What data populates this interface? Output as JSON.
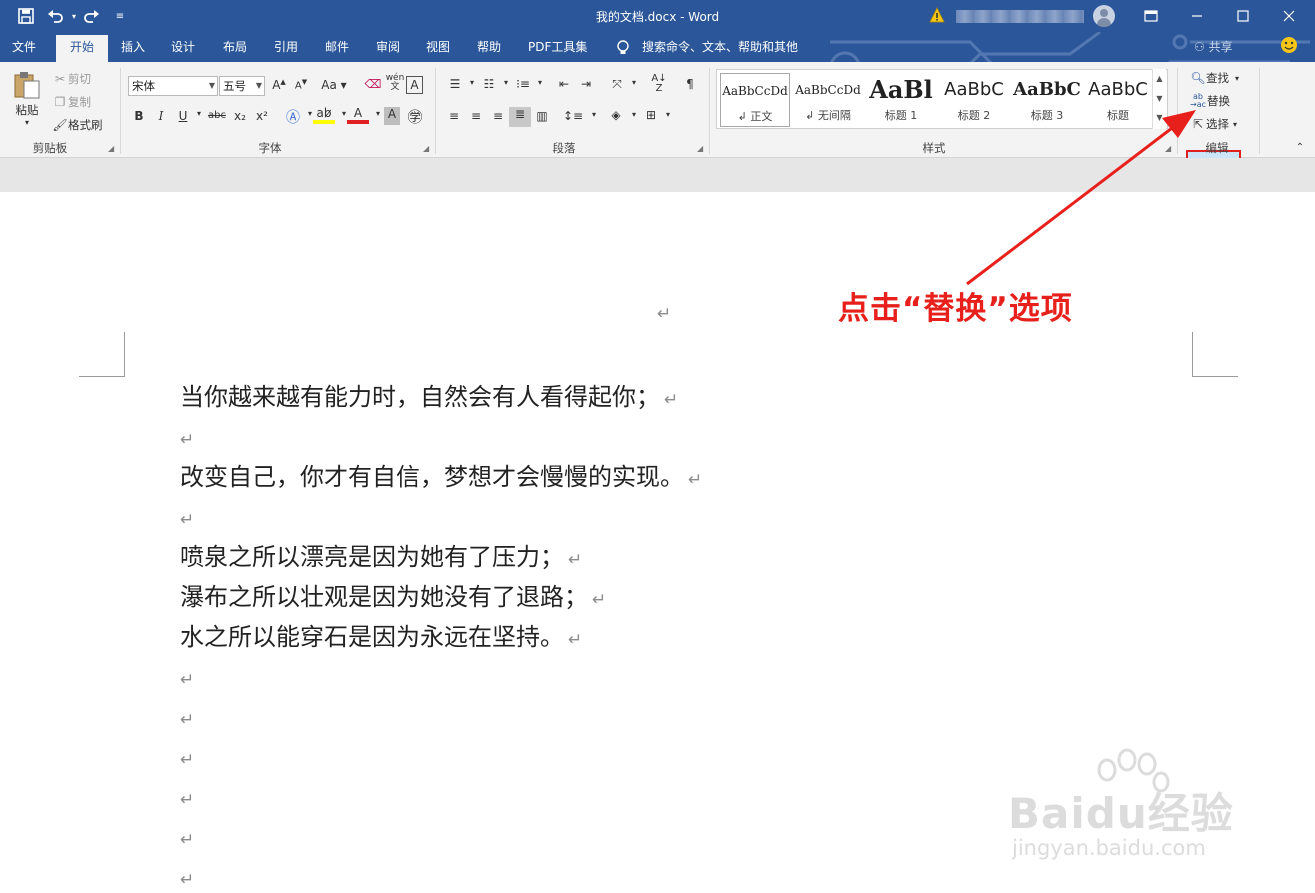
{
  "titlebar": {
    "title": "我的文档.docx  -  Word",
    "user_name": "▓▓▓▓▓▓▓▓▓▓▓▓"
  },
  "tabs": [
    "文件",
    "开始",
    "插入",
    "设计",
    "布局",
    "引用",
    "邮件",
    "审阅",
    "视图",
    "帮助",
    "PDF工具集"
  ],
  "search_hint": "搜索命令、文本、帮助和其他",
  "share_label": "共享",
  "clipboard": {
    "paste": "粘贴",
    "cut": "剪切",
    "copy": "复制",
    "format_painter": "格式刷",
    "group": "剪贴板"
  },
  "font": {
    "name": "宋体",
    "size": "五号",
    "group": "字体",
    "bold": "B",
    "italic": "I",
    "underline": "U",
    "strike": "abc",
    "subscript": "x₂",
    "superscript": "x²"
  },
  "paragraph": {
    "group": "段落"
  },
  "styles": {
    "group": "样式",
    "items": [
      {
        "preview": "AaBbCcDd",
        "name": "↲ 正文"
      },
      {
        "preview": "AaBbCcDd",
        "name": "↲ 无间隔"
      },
      {
        "preview": "AaBl",
        "name": "标题 1"
      },
      {
        "preview": "AaBbC",
        "name": "标题 2"
      },
      {
        "preview": "AaBbC",
        "name": "标题 3"
      },
      {
        "preview": "AaBbC",
        "name": "标题"
      }
    ]
  },
  "editing": {
    "find": "查找",
    "replace": "替换",
    "select": "选择",
    "group": "编辑"
  },
  "document": {
    "paragraphs": [
      "当你越来越有能力时，自然会有人看得起你；",
      "",
      "改变自己，你才有自信，梦想才会慢慢的实现。",
      "",
      "喷泉之所以漂亮是因为她有了压力；",
      "瀑布之所以壮观是因为她没有了退路；",
      "水之所以能穿石是因为永远在坚持。",
      "",
      "",
      "",
      "",
      "",
      ""
    ],
    "pilcrow": "↵"
  },
  "annotation": "点击“替换”选项",
  "watermark": {
    "brand": "Baidu经验",
    "url": "jingyan.baidu.com"
  },
  "colors": {
    "titlebar": "#2b579a",
    "annotation": "#e8201c"
  }
}
